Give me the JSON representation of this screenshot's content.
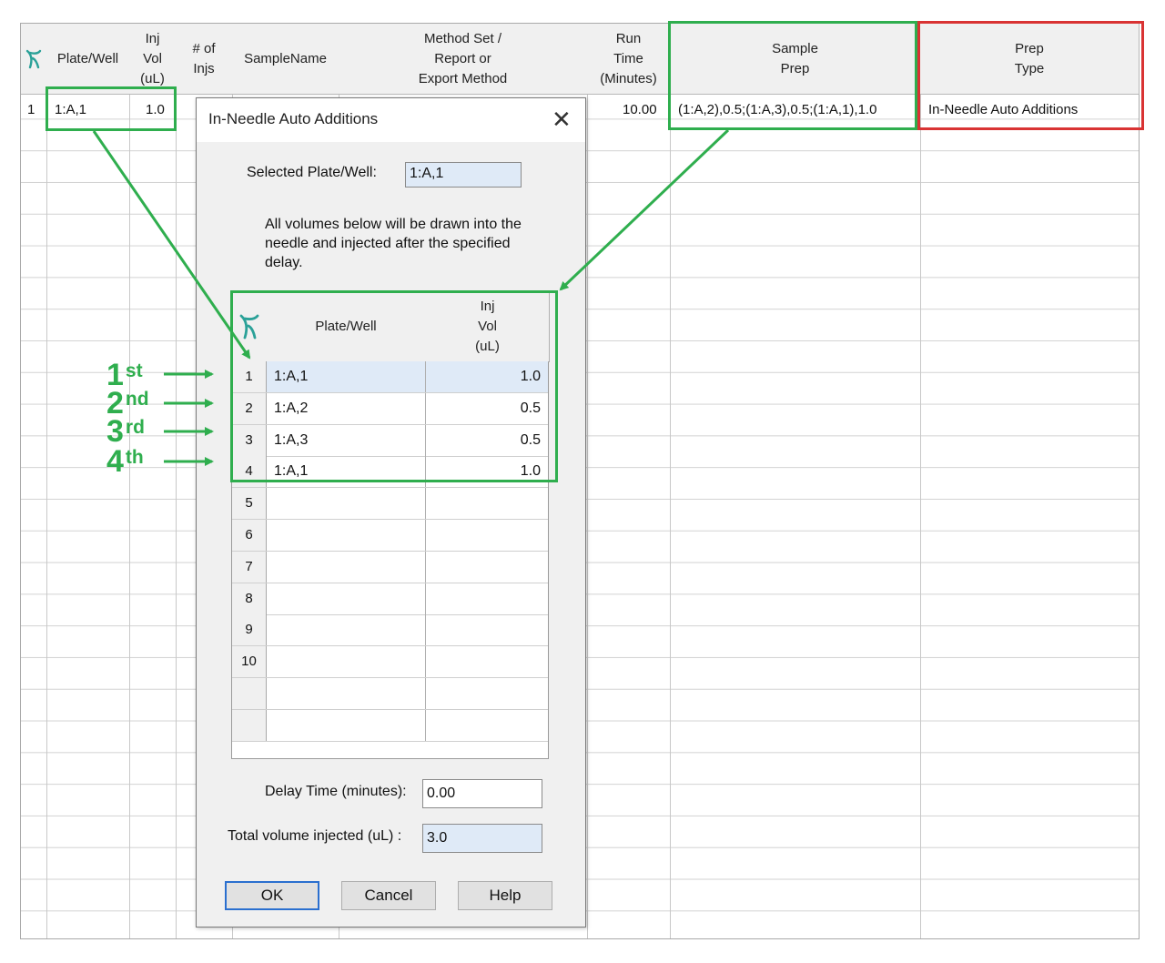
{
  "grid": {
    "headers": {
      "logo": "",
      "plate_well": "Plate/Well",
      "inj_vol": "Inj\nVol\n(uL)",
      "num_injs": "# of\nInjs",
      "sample_name": "SampleName",
      "method_set": "Method Set /\nReport or\nExport Method",
      "run_time": "Run\nTime\n(Minutes)",
      "sample_prep": "Sample\nPrep",
      "prep_type": "Prep\nType"
    },
    "row1": {
      "num": "1",
      "plate_well": "1:A,1",
      "inj_vol": "1.0",
      "run_time": "10.00",
      "sample_prep": "(1:A,2),0.5;(1:A,3),0.5;(1:A,1),1.0",
      "prep_type": "In-Needle Auto Additions"
    }
  },
  "dialog": {
    "title": "In-Needle Auto Additions",
    "close_symbol": "✕",
    "selected_label": "Selected Plate/Well:",
    "selected_value": "1:A,1",
    "note": "All volumes below will be drawn into the needle and injected after the specified delay.",
    "table": {
      "col_plate_well": "Plate/Well",
      "col_inj_vol": "Inj\nVol\n(uL)",
      "rows": [
        {
          "num": "1",
          "plate_well": "1:A,1",
          "vol": "1.0"
        },
        {
          "num": "2",
          "plate_well": "1:A,2",
          "vol": "0.5"
        },
        {
          "num": "3",
          "plate_well": "1:A,3",
          "vol": "0.5"
        },
        {
          "num": "4",
          "plate_well": "1:A,1",
          "vol": "1.0"
        },
        {
          "num": "5",
          "plate_well": "",
          "vol": ""
        },
        {
          "num": "6",
          "plate_well": "",
          "vol": ""
        },
        {
          "num": "7",
          "plate_well": "",
          "vol": ""
        },
        {
          "num": "8",
          "plate_well": "",
          "vol": ""
        },
        {
          "num": "9",
          "plate_well": "",
          "vol": ""
        },
        {
          "num": "10",
          "plate_well": "",
          "vol": ""
        },
        {
          "num": "",
          "plate_well": "",
          "vol": ""
        },
        {
          "num": "",
          "plate_well": "",
          "vol": ""
        }
      ]
    },
    "delay_label": "Delay Time (minutes):",
    "delay_value": "0.00",
    "total_label": "Total volume injected (uL) :",
    "total_value": "3.0",
    "ok_label": "OK",
    "cancel_label": "Cancel",
    "help_label": "Help"
  },
  "annotations": {
    "order": [
      {
        "num": "1",
        "suffix": "st"
      },
      {
        "num": "2",
        "suffix": "nd"
      },
      {
        "num": "3",
        "suffix": "rd"
      },
      {
        "num": "4",
        "suffix": "th"
      }
    ],
    "green": "#2fae4e",
    "red": "#d93333"
  },
  "icons": {
    "logo": "waters-logo-icon",
    "close": "close-icon"
  }
}
